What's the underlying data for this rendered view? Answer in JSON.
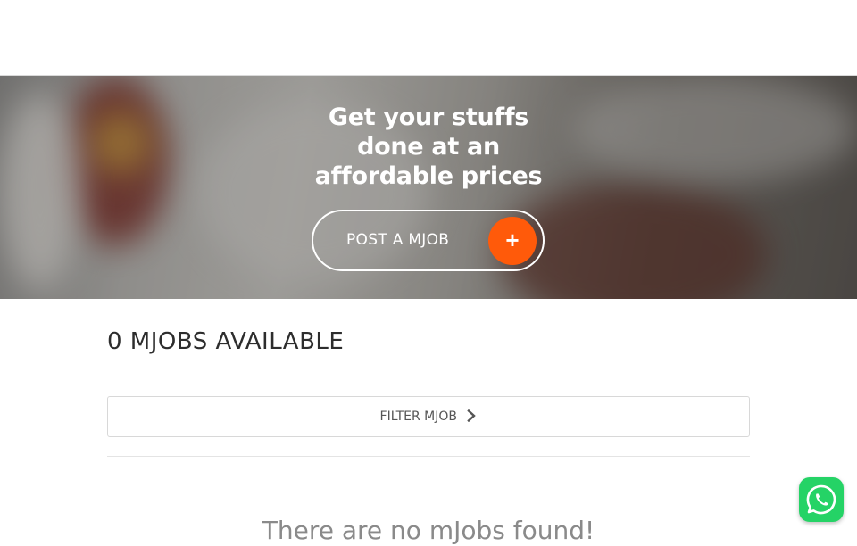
{
  "hero": {
    "title_lines": [
      "Get your stuffs",
      "done at an",
      "affordable prices"
    ],
    "post_button_label": "POST A MJOB",
    "post_button_icon": "plus-icon",
    "accent_color": "#ff5a0a"
  },
  "listing": {
    "count_heading": "0 MJOBS AVAILABLE",
    "filter_label": "FILTER MJOB",
    "filter_icon": "chevron-right-icon",
    "empty_message": "There are no mJobs found!"
  },
  "widgets": {
    "whatsapp_icon": "whatsapp-icon",
    "whatsapp_color": "#25d366"
  }
}
